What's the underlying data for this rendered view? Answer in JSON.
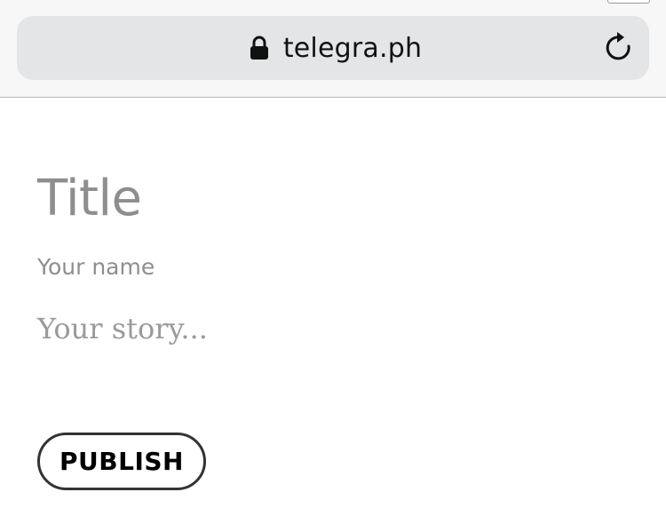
{
  "browser": {
    "url": "telegra.ph",
    "lock_icon": "lock-icon",
    "reload_icon": "reload-icon"
  },
  "editor": {
    "title_placeholder": "Title",
    "author_placeholder": "Your name",
    "story_placeholder": "Your story...",
    "publish_label": "PUBLISH"
  },
  "colors": {
    "chrome_background": "#f7f7f7",
    "address_bar": "#e4e5e7",
    "placeholder_text": "#8e8e8e",
    "button_border": "#333333"
  }
}
